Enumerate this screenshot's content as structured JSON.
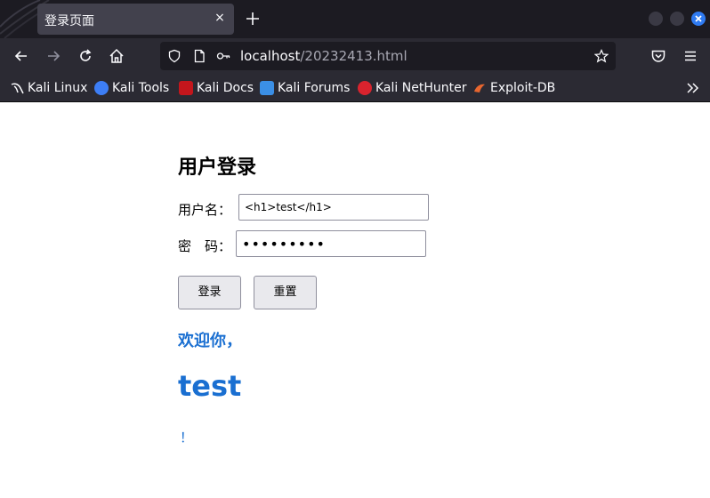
{
  "browser": {
    "tab_title": "登录页面",
    "tab_close": "×",
    "url_host": "localhost",
    "url_path": "/20232413.html",
    "bookmarks": [
      {
        "label": "Kali Linux",
        "icon": "kali-dragon-icon",
        "color": "#367bf0"
      },
      {
        "label": "Kali Tools",
        "icon": "kali-tools-icon",
        "color": "#3d7ef6"
      },
      {
        "label": "Kali Docs",
        "icon": "kali-docs-icon",
        "color": "#c4161c"
      },
      {
        "label": "Kali Forums",
        "icon": "kali-forums-icon",
        "color": "#3b8fe6"
      },
      {
        "label": "Kali NetHunter",
        "icon": "kali-nethunter-icon",
        "color": "#d9232e"
      },
      {
        "label": "Exploit-DB",
        "icon": "exploit-db-icon",
        "color": "#e8662f"
      }
    ]
  },
  "page": {
    "title": "用户登录",
    "username_label": "用户名：",
    "username_value": "<h1>test</h1>",
    "password_label": "密　码：",
    "password_value": "123456789",
    "login_button": "登录",
    "reset_button": "重置",
    "welcome_text": "欢迎你，",
    "username_display": "test",
    "exclaim": "！"
  },
  "colors": {
    "welcome_blue": "#1a6fd1",
    "chrome_dark": "#1c1b22",
    "chrome_toolbar": "#2b2a33"
  }
}
